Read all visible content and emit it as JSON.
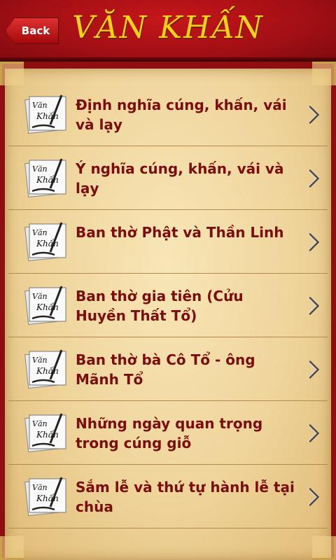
{
  "header": {
    "back_label": "Back",
    "title": "VĂN KHẤN"
  },
  "colors": {
    "header_red": "#a10f14",
    "title_gold": "#f7d21a",
    "item_text": "#7a0d0d",
    "parchment": "#efd49b"
  },
  "thumbnail_text": "Văn Khấn",
  "items": [
    {
      "label": "Định nghĩa cúng, khấn, vái và lạy"
    },
    {
      "label": "Ý nghĩa cúng, khấn, vái và lạy"
    },
    {
      "label": "Ban thờ Phật và Thần Linh"
    },
    {
      "label": "Ban thờ gia tiên (Cửu Huyền Thất Tổ)"
    },
    {
      "label": "Ban thờ bà Cô Tổ - ông Mãnh Tổ"
    },
    {
      "label": "Những ngày quan trọng trong cúng giỗ"
    },
    {
      "label": "Sắm lễ và thứ tự hành lễ tại chùa"
    }
  ]
}
